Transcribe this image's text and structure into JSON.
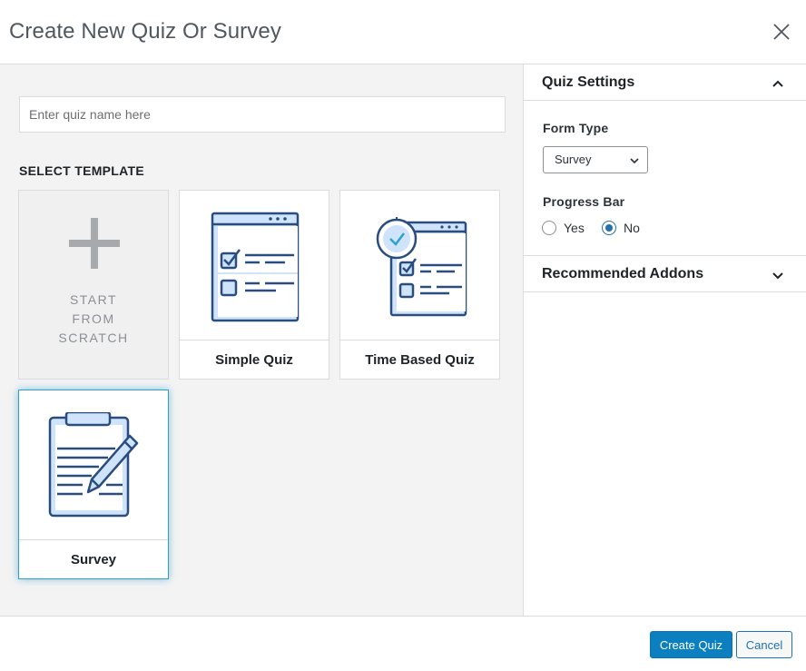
{
  "modal": {
    "title": "Create New Quiz Or Survey",
    "close_icon": "close-icon"
  },
  "quiz_name": {
    "placeholder": "Enter quiz name here",
    "value": ""
  },
  "templates": {
    "heading": "SELECT TEMPLATE",
    "items": [
      {
        "id": "scratch",
        "label": "START FROM SCRATCH",
        "line1": "START",
        "line2": "FROM",
        "line3": "SCRATCH",
        "icon": "plus-icon"
      },
      {
        "id": "simple",
        "label": "Simple Quiz",
        "icon": "simple-quiz-icon"
      },
      {
        "id": "timed",
        "label": "Time Based Quiz",
        "icon": "time-based-quiz-icon"
      },
      {
        "id": "survey",
        "label": "Survey",
        "icon": "survey-clipboard-icon",
        "selected": true
      }
    ]
  },
  "settings": {
    "quiz_settings_title": "Quiz Settings",
    "form_type_label": "Form Type",
    "form_type_value": "Survey",
    "progress_bar_label": "Progress Bar",
    "progress_options": [
      {
        "label": "Yes",
        "checked": false
      },
      {
        "label": "No",
        "checked": true
      }
    ],
    "addons_title": "Recommended Addons"
  },
  "footer": {
    "create_label": "Create Quiz",
    "cancel_label": "Cancel"
  },
  "colors": {
    "primary": "#0b7fc0",
    "icon_stroke": "#2a4d80",
    "icon_fill": "#cfe3fb",
    "selected_border": "#2ea2cc"
  }
}
